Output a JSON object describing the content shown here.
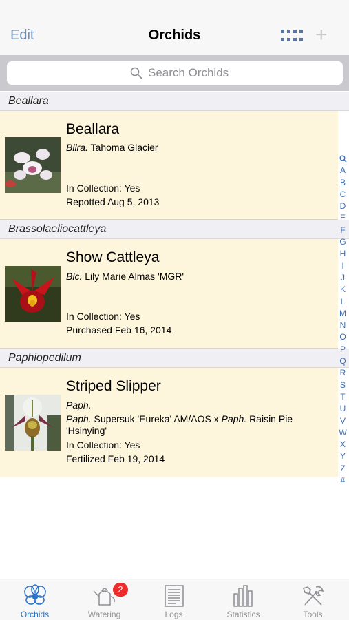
{
  "nav": {
    "edit_label": "Edit",
    "title": "Orchids",
    "grid_icon": "grid-icon",
    "add_icon": "plus-icon"
  },
  "search": {
    "placeholder": "Search Orchids"
  },
  "sections": [
    {
      "header": "Beallara",
      "item": {
        "name": "Beallara",
        "genus_abbr": "Bllra.",
        "grex": "Tahoma Glacier",
        "collection": "In Collection: Yes",
        "event": "Repotted Aug 5, 2013"
      }
    },
    {
      "header": "Brassolaeliocattleya",
      "item": {
        "name": "Show Cattleya",
        "genus_abbr": "Blc.",
        "grex": "Lily Marie Almas 'MGR'",
        "collection": "In Collection: Yes",
        "event": "Purchased Feb 16, 2014"
      }
    },
    {
      "header": "Paphiopedilum",
      "item": {
        "name": "Striped Slipper",
        "genus_abbr": "Paph.",
        "cross_parent1_abbr": "Paph.",
        "cross_parent1": "Supersuk 'Eureka' AM/AOS x",
        "cross_parent2_abbr": "Paph.",
        "cross_parent2": "Raisin Pie",
        "cross_line2": "'Hsinying'",
        "collection": "In Collection: Yes",
        "event": "Fertilized Feb 19, 2014"
      }
    }
  ],
  "index": [
    "Q",
    "A",
    "B",
    "C",
    "D",
    "E",
    "F",
    "G",
    "H",
    "I",
    "J",
    "K",
    "L",
    "M",
    "N",
    "O",
    "P",
    "Q",
    "R",
    "S",
    "T",
    "U",
    "V",
    "W",
    "X",
    "Y",
    "Z",
    "#"
  ],
  "tabs": [
    {
      "label": "Orchids",
      "icon": "orchid-icon",
      "active": true
    },
    {
      "label": "Watering",
      "icon": "watering-can-icon",
      "badge": "2"
    },
    {
      "label": "Logs",
      "icon": "log-document-icon"
    },
    {
      "label": "Statistics",
      "icon": "bar-chart-icon"
    },
    {
      "label": "Tools",
      "icon": "tools-icon"
    }
  ],
  "colors": {
    "accent": "#2d73c9",
    "edit": "#6e8fb5",
    "row_bg": "#fdf6dc",
    "badge": "#ee2b2b"
  }
}
